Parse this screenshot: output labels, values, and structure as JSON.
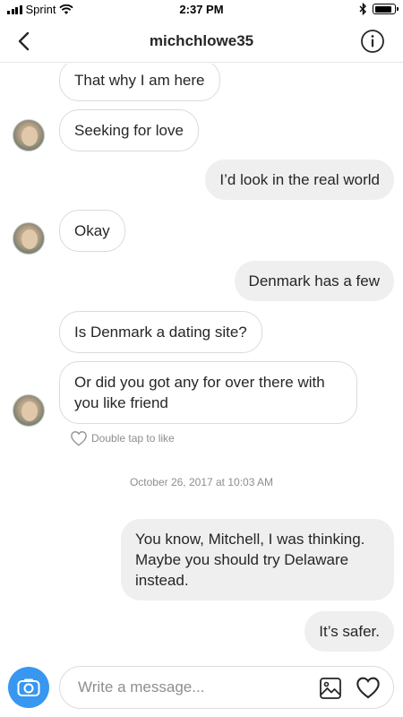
{
  "status_bar": {
    "carrier": "Sprint",
    "time": "2:37 PM",
    "battery_level": 0.9
  },
  "header": {
    "title": "michchlowe35",
    "back_icon": "chevron-left-icon",
    "info_icon": "info-icon"
  },
  "messages": [
    {
      "sender": "them",
      "text": "That why I am here",
      "avatar": false
    },
    {
      "sender": "them",
      "text": "Seeking for love",
      "avatar": true
    },
    {
      "sender": "me",
      "text": "I’d look in the real world"
    },
    {
      "sender": "them",
      "text": "Okay",
      "avatar": true
    },
    {
      "sender": "me",
      "text": "Denmark has a few"
    },
    {
      "sender": "them",
      "text": "Is Denmark a dating site?",
      "avatar": false
    },
    {
      "sender": "them",
      "text": "Or did you got any for over there with you like friend",
      "avatar": true
    },
    {
      "sender": "me",
      "text": "You know, Mitchell, I was thinking. Maybe you should try Delaware instead."
    },
    {
      "sender": "me",
      "text": "It’s safer."
    }
  ],
  "like_hint": "Double tap to like",
  "timestamp": "October 26, 2017 at 10:03 AM",
  "composer": {
    "placeholder": "Write a message...",
    "camera_icon": "camera-icon",
    "gallery_icon": "gallery-icon",
    "heart_icon": "heart-icon"
  },
  "colors": {
    "accent": "#3897f0",
    "outgoing_bubble": "#efefef",
    "incoming_border": "#dbdbdb",
    "muted_text": "#8e8e8e"
  }
}
